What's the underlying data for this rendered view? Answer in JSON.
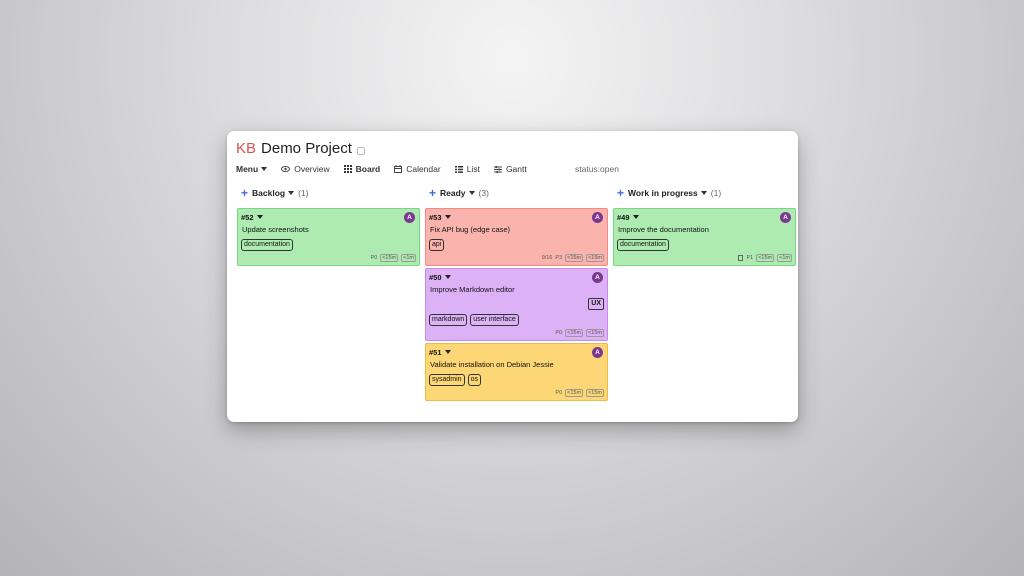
{
  "header": {
    "logo": "KB",
    "project_title": "Demo Project"
  },
  "nav": {
    "menu": "Menu",
    "overview": "Overview",
    "board": "Board",
    "calendar": "Calendar",
    "list": "List",
    "gantt": "Gantt",
    "search_value": "status:open"
  },
  "columns": [
    {
      "title": "Backlog",
      "count": "(1)"
    },
    {
      "title": "Ready",
      "count": "(3)"
    },
    {
      "title": "Work in progress",
      "count": "(1)"
    }
  ],
  "cards": {
    "c52": {
      "id": "#52",
      "title": "Update screenshots",
      "tags": [
        "documentation"
      ],
      "priority": "P0",
      "t1": "<15m",
      "t2": "<1m",
      "color": "#adebb1"
    },
    "c53": {
      "id": "#53",
      "title": "Fix API bug (edge case)",
      "tags": [
        "api"
      ],
      "date": "9/16",
      "priority": "P3",
      "t1": "<15m",
      "t2": "<15m",
      "color": "#fbb3ae"
    },
    "c50": {
      "id": "#50",
      "title": "Improve Markdown editor",
      "badge": "UX",
      "tags": [
        "markdown",
        "user interface"
      ],
      "priority": "P0",
      "t1": "<15m",
      "t2": "<15m",
      "color": "#dcb1f5"
    },
    "c51": {
      "id": "#51",
      "title": "Validate installation on Debian Jessie",
      "tags": [
        "sysadmin",
        "os"
      ],
      "priority": "P0",
      "t1": "<15m",
      "t2": "<15m",
      "color": "#fdd776"
    },
    "c49": {
      "id": "#49",
      "title": "Improve the documentation",
      "tags": [
        "documentation"
      ],
      "priority": "P1",
      "t1": "<15m",
      "t2": "<1m",
      "color": "#adebb1"
    }
  },
  "avatar_letter": "A",
  "colors": {
    "accent": "#3a6fd8",
    "logo": "#d9534f",
    "avatar": "#7c3790"
  }
}
